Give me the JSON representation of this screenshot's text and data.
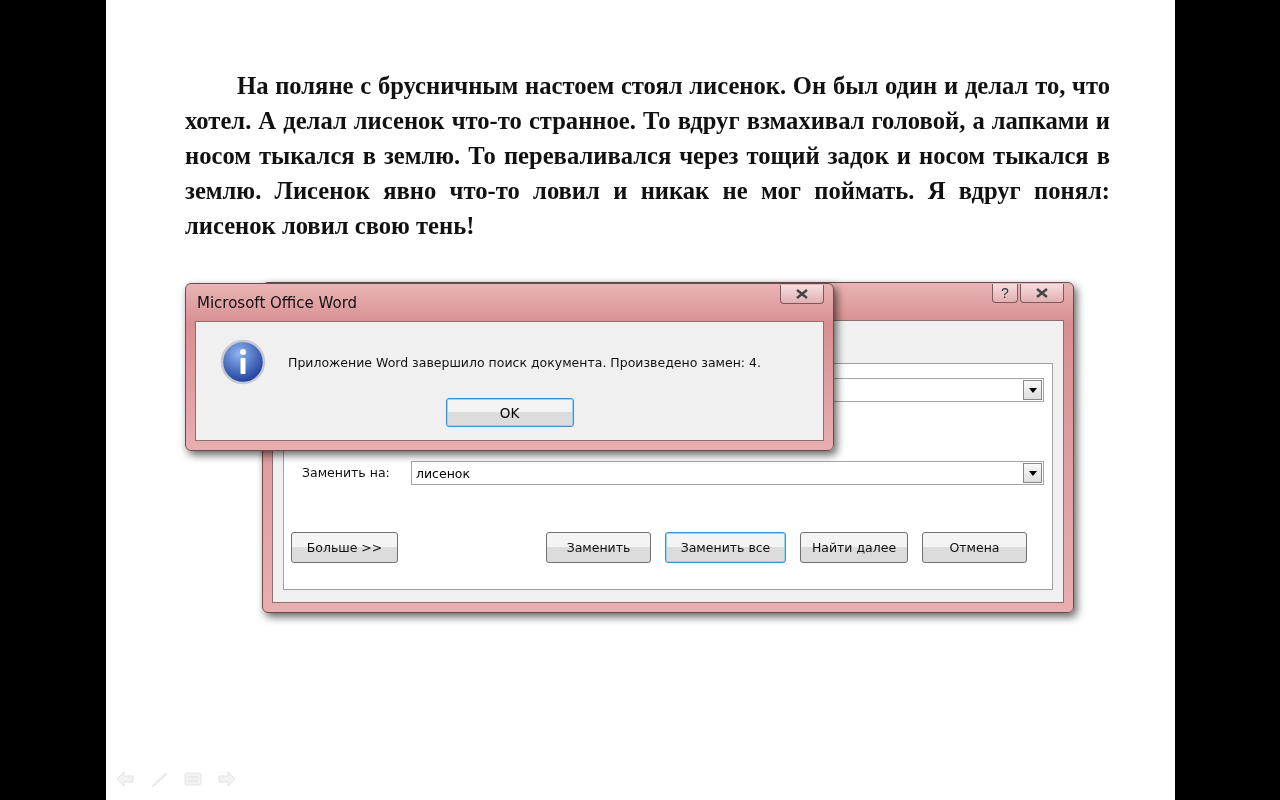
{
  "slide": {
    "paragraph": "На поляне с брусничным настоем стоял лисенок. Он был один и делал то, что хотел. А делал лисенок что-то странное. То вдруг взмахивал головой, а лапками и носом тыкался в землю. То переваливался через тощий задок и носом тыкался в землю. Лисенок явно что-то ловил и никак не мог поймать. Я вдруг понял: лисенок ловил свою тень!"
  },
  "replace_dialog": {
    "help_button": "?",
    "replace_label": "Заменить на:",
    "replace_value": "лисенок",
    "buttons": [
      {
        "label": "Больше >>",
        "focused": false
      },
      {
        "label": "Заменить",
        "focused": false
      },
      {
        "label": "Заменить все",
        "focused": true
      },
      {
        "label": "Найти далее",
        "focused": false
      },
      {
        "label": "Отмена",
        "focused": false
      }
    ]
  },
  "message_box": {
    "title": "Microsoft Office Word",
    "message": "Приложение Word завершило поиск документа. Произведено замен: 4.",
    "button": "OK"
  }
}
